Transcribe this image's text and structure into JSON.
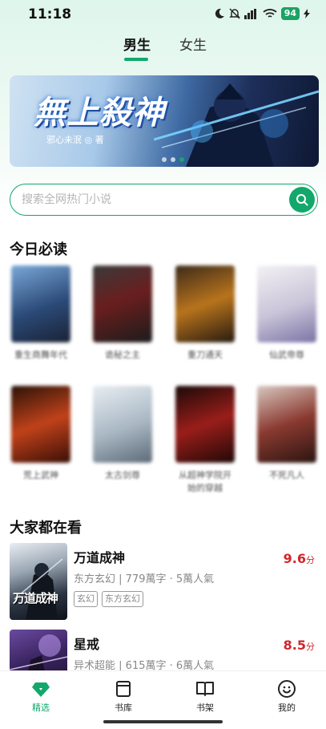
{
  "status_bar": {
    "time": "11:18",
    "battery": "94"
  },
  "gender_tabs": [
    {
      "label": "男生",
      "active": true
    },
    {
      "label": "女生",
      "active": false
    }
  ],
  "banner": {
    "title": "無上殺神",
    "author": "邪心未泯 ◎ 著",
    "slide_count": 3,
    "active_slide": 3
  },
  "search": {
    "placeholder": "搜索全网热门小说",
    "value": ""
  },
  "daily_section": {
    "title": "今日必读",
    "books": [
      {
        "title": "重生商舞年代"
      },
      {
        "title": "诡秘之主"
      },
      {
        "title": "重刀通天"
      },
      {
        "title": "仙武帝尊"
      },
      {
        "title": "荒上武神"
      },
      {
        "title": "太古剑尊"
      },
      {
        "title": "从超神学院开始的穿越"
      },
      {
        "title": "不死凡人"
      }
    ]
  },
  "popular_section": {
    "title": "大家都在看",
    "items": [
      {
        "title": "万道成神",
        "genre": "东方玄幻",
        "words": "779萬字",
        "readers": "5萬人氣",
        "tags": [
          "玄幻",
          "东方玄幻"
        ],
        "score": "9.6",
        "score_unit": "分",
        "cover_text": "万道成神"
      },
      {
        "title": "星戒",
        "genre": "异术超能",
        "words": "615萬字",
        "readers": "6萬人氣",
        "tags": [],
        "score": "8.5",
        "score_unit": "分",
        "cover_text": ""
      }
    ]
  },
  "bottom_nav": [
    {
      "label": "精选",
      "icon": "diamond-icon",
      "active": true
    },
    {
      "label": "书库",
      "icon": "library-icon",
      "active": false
    },
    {
      "label": "书架",
      "icon": "open-book-icon",
      "active": false
    },
    {
      "label": "我的",
      "icon": "smiley-icon",
      "active": false
    }
  ],
  "colors": {
    "accent": "#13a86b",
    "score": "#d0262c"
  }
}
